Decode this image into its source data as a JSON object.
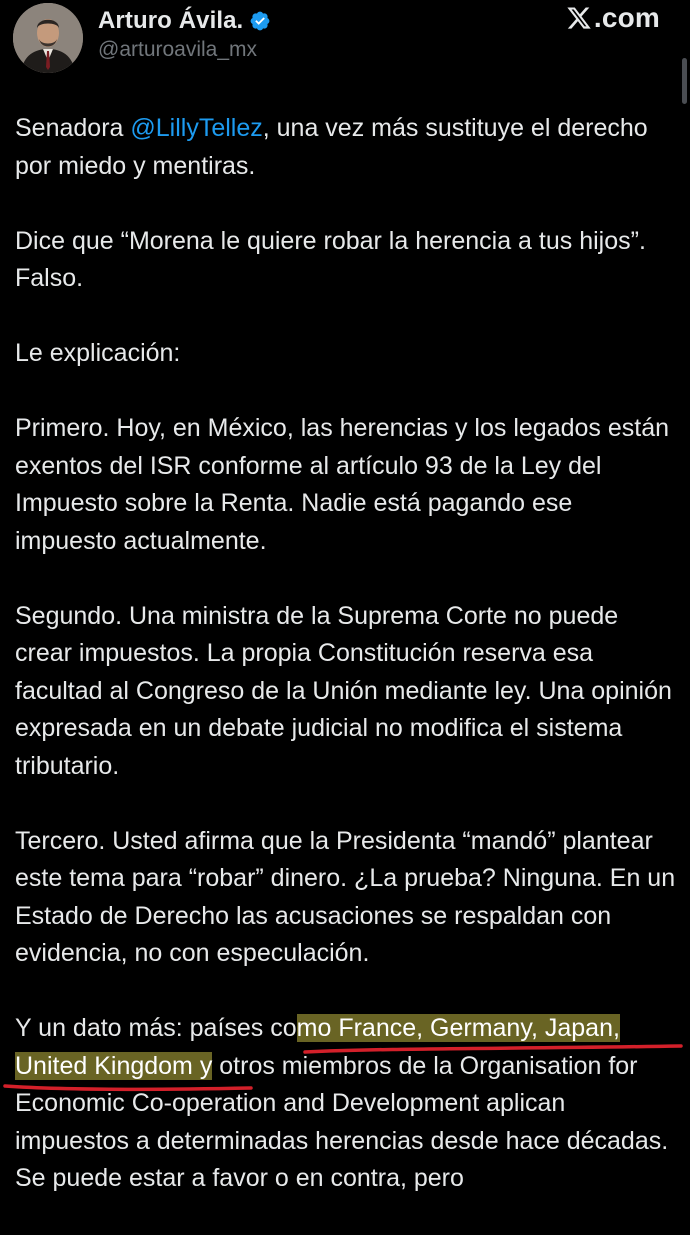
{
  "header": {
    "display_name": "Arturo Ávila.",
    "handle": "@arturoavila_mx",
    "brand_text": ".com",
    "avatar_icon": "avatar-photo",
    "verified_icon": "verified-badge-icon",
    "brand_icon": "x-logo-icon",
    "verified_color": "#1d9bf0"
  },
  "tweet": {
    "p1_prefix": "Senadora ",
    "p1_mention": "@LillyTellez",
    "p1_suffix": ", una vez más sustituye el derecho por miedo y mentiras.",
    "p2": "Dice que “Morena le quiere robar la herencia a tus hijos”. Falso.",
    "p3": "Le explicación:",
    "p4": "Primero. Hoy, en México, las herencias y los legados están exentos del ISR conforme al artículo 93 de la Ley del Impuesto sobre la Renta. Nadie está pagando ese impuesto actualmente.",
    "p5": "Segundo. Una ministra de la Suprema Corte no puede crear impuestos. La propia Constitución reserva esa facultad al Congreso de la Unión mediante ley. Una opinión expresada en un debate judicial no modifica el sistema tributario.",
    "p6": "Tercero. Usted afirma que la Presidenta “mandó” plantear este tema para “robar” dinero. ¿La prueba? Ninguna. En un Estado de Derecho las acusaciones se respaldan con evidencia, no con especulación.",
    "p7_before": "Y un dato más: países co",
    "p7_highlight_1": "mo France, Germany, Japan, United Kingdom y",
    "p7_after": " otros miembros de la Organisation for Economic Co-operation and Development aplican impuestos a determinadas herencias desde hace décadas. Se puede estar a favor o en contra, pero"
  },
  "colors": {
    "background": "#000000",
    "text": "#e7e9ea",
    "secondary_text": "#71767b",
    "link": "#1d9bf0",
    "highlighter": "#e8de50",
    "annotation_underline": "#d3202a"
  }
}
